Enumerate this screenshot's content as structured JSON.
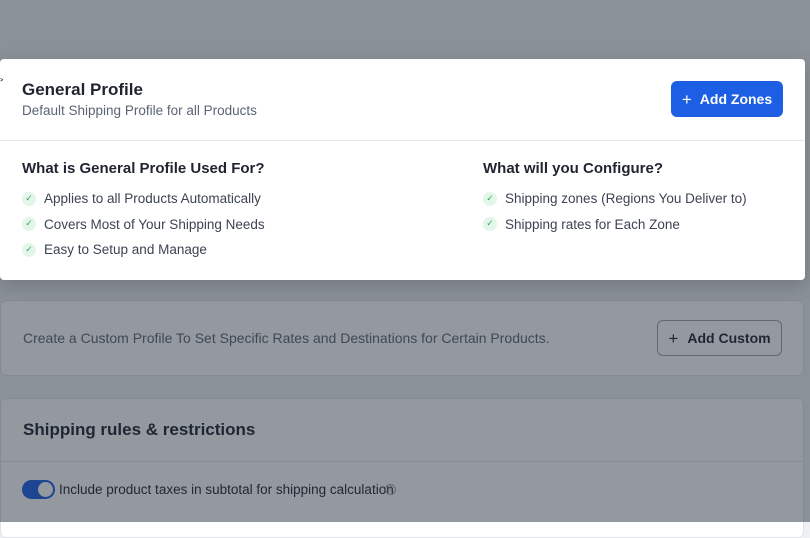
{
  "background": {
    "custom_profile": {
      "text": "Create a Custom Profile To Set Specific Rates and Destinations for Certain Products.",
      "button_label": "Add Custom",
      "button_icon": "plus-icon"
    },
    "rules": {
      "title": "Shipping rules & restrictions",
      "toggle_on": true,
      "toggle_label": "Include product taxes in subtotal for shipping calculation",
      "info_icon": "info-icon"
    }
  },
  "modal": {
    "title": "General Profile",
    "subtitle": "Default Shipping Profile for all Products",
    "primary_button": {
      "label": "Add Zones",
      "icon": "plus-icon"
    },
    "left_column": {
      "heading": "What is General Profile Used For?",
      "items": [
        "Applies to all Products Automatically",
        "Covers Most of Your Shipping Needs",
        "Easy to Setup and Manage"
      ]
    },
    "right_column": {
      "heading": "What will you Configure?",
      "items": [
        "Shipping zones (Regions You Deliver to)",
        "Shipping rates for Each Zone"
      ]
    }
  },
  "colors": {
    "accent": "#1c5fe5",
    "check": "#2fa85a",
    "check_bg": "#e4f6ea",
    "overlay": "rgba(31,41,55,0.48)"
  }
}
